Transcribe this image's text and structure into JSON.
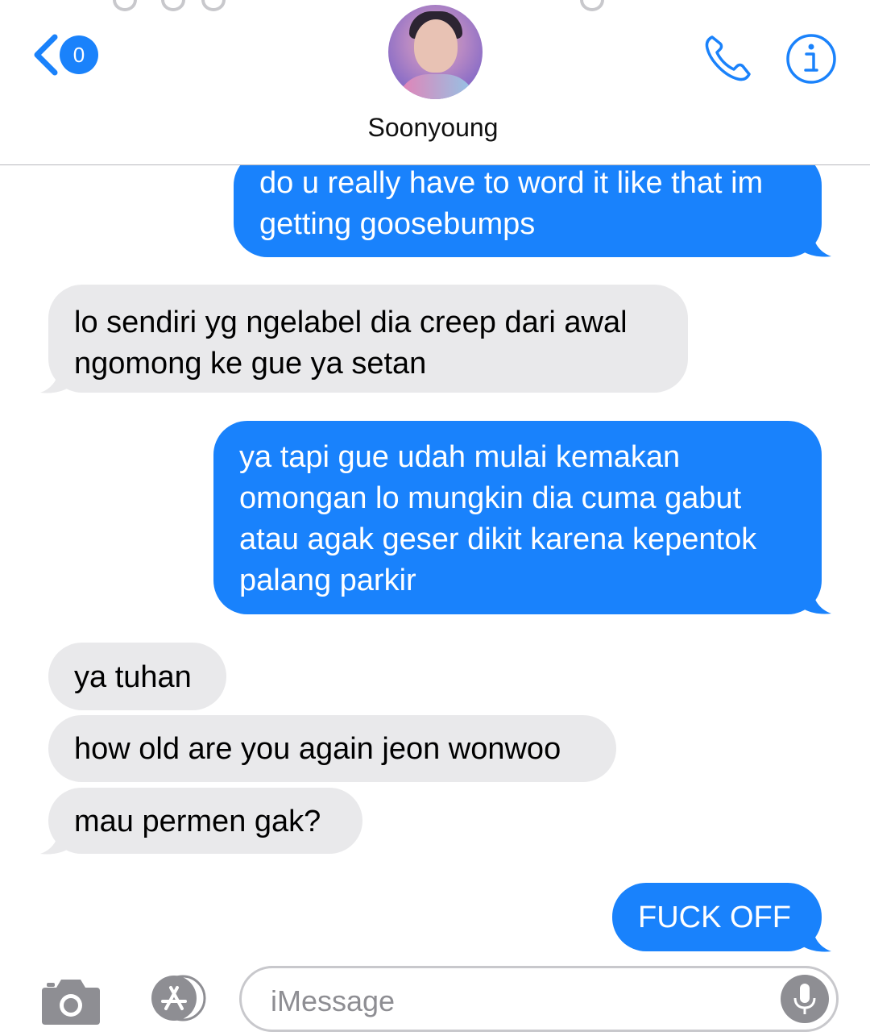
{
  "header": {
    "back_badge_count": "0",
    "contact_name": "Soonyoung",
    "back_icon": "chevron-left-icon",
    "call_icon": "phone-icon",
    "info_icon": "info-icon"
  },
  "messages": [
    {
      "direction": "sent",
      "lines": [
        "do u really have to word it like that im",
        "getting goosebumps"
      ]
    },
    {
      "direction": "received",
      "lines": [
        "lo sendiri yg ngelabel dia creep dari awal",
        "ngomong ke gue ya setan"
      ]
    },
    {
      "direction": "sent",
      "lines": [
        "ya tapi gue udah mulai kemakan",
        "omongan lo mungkin dia cuma gabut",
        "atau agak geser dikit karena kepentok",
        "palang parkir"
      ]
    },
    {
      "direction": "received",
      "lines": [
        "ya tuhan"
      ]
    },
    {
      "direction": "received",
      "lines": [
        "how old are you again jeon wonwoo"
      ]
    },
    {
      "direction": "received",
      "lines": [
        "mau permen gak?"
      ]
    },
    {
      "direction": "sent",
      "lines": [
        "FUCK OFF"
      ]
    }
  ],
  "input_bar": {
    "placeholder": "iMessage",
    "camera_icon": "camera-icon",
    "apps_icon": "app-store-icon",
    "mic_icon": "microphone-icon"
  },
  "colors": {
    "sent_bubble": "#1982fc",
    "received_bubble": "#e9e9eb",
    "accent": "#1a82fb"
  }
}
